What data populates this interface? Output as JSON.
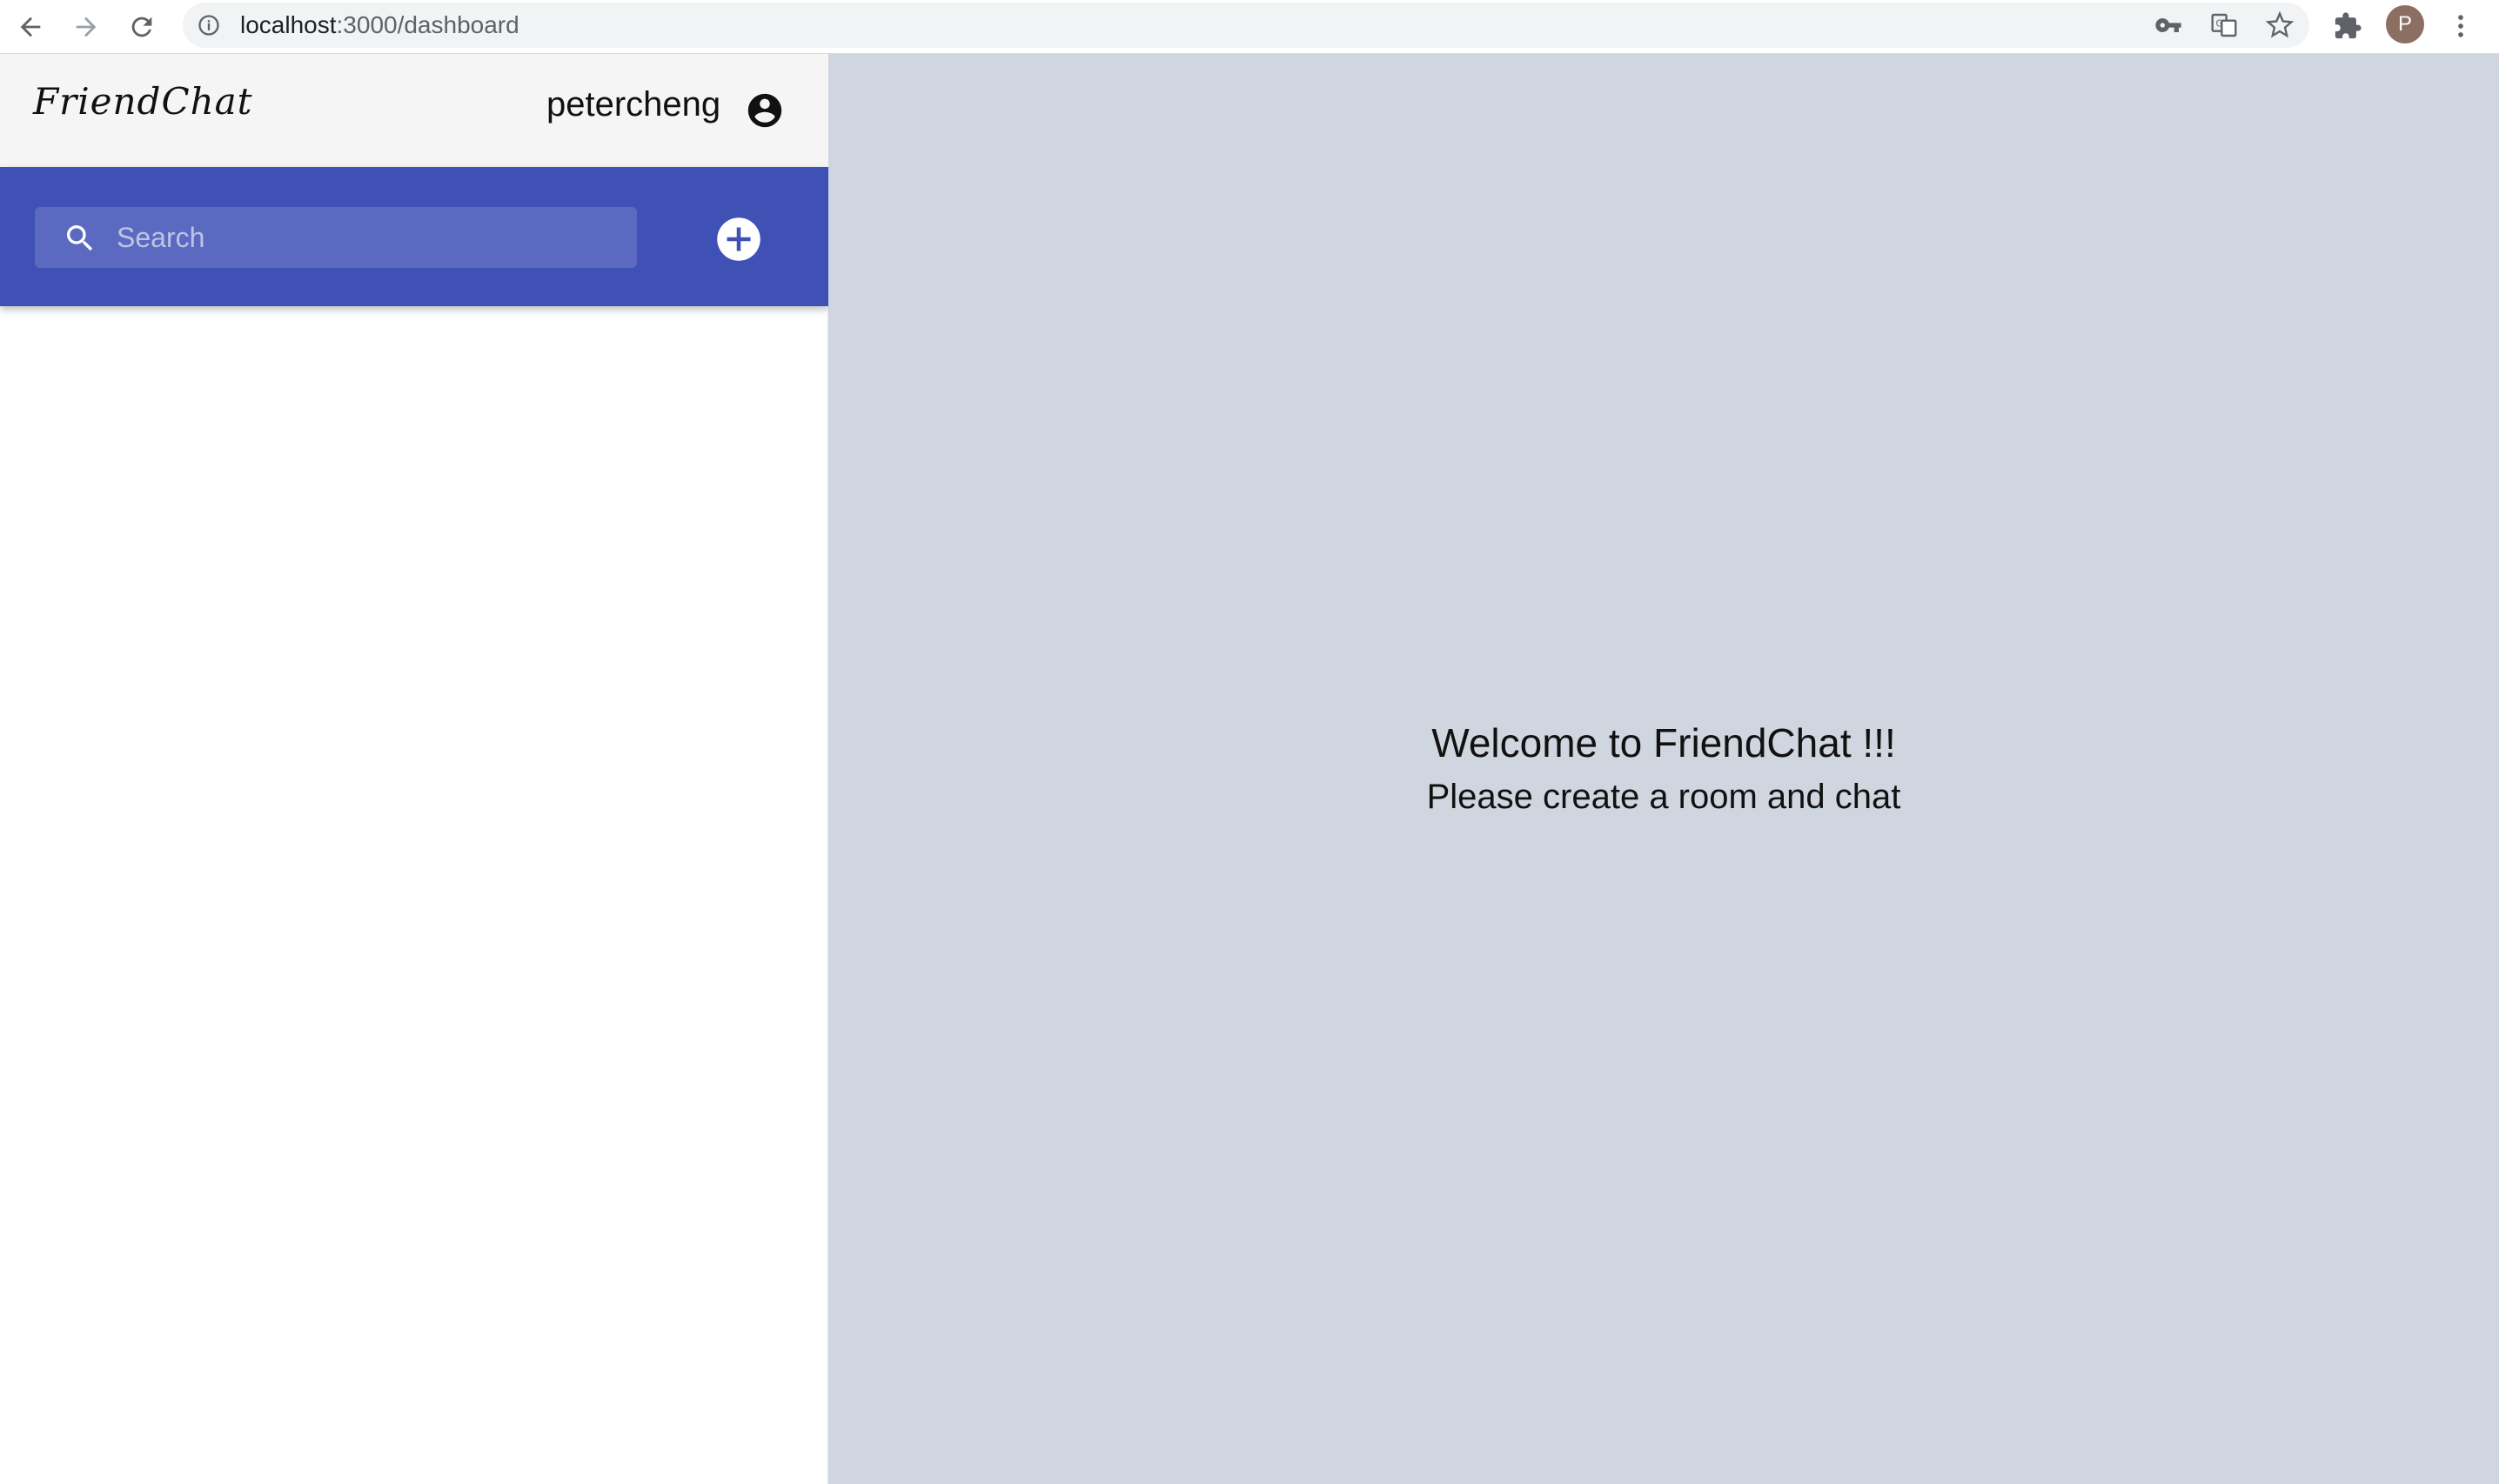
{
  "browser": {
    "url_host": "localhost",
    "url_path": ":3000/dashboard",
    "profile_initial": "P"
  },
  "sidebar": {
    "logo": "FriendChat",
    "username": "petercheng",
    "search": {
      "placeholder": "Search",
      "value": ""
    },
    "room_count": 0
  },
  "main": {
    "welcome_title": "Welcome to FriendChat !!!",
    "welcome_subtitle": "Please create a room and chat"
  },
  "colors": {
    "accent": "#3f51b5",
    "main_bg": "#cfd6df",
    "header_bg": "#f5f5f5"
  },
  "icons": {
    "back": "arrow-left-icon",
    "forward": "arrow-right-icon",
    "reload": "reload-icon",
    "site_info": "info-icon",
    "password": "key-icon",
    "translate": "translate-icon",
    "bookmark": "star-icon",
    "extensions": "puzzle-icon",
    "menu": "more-vert-icon",
    "account": "account-circle-icon",
    "search": "search-icon",
    "add": "add-circle-icon"
  }
}
